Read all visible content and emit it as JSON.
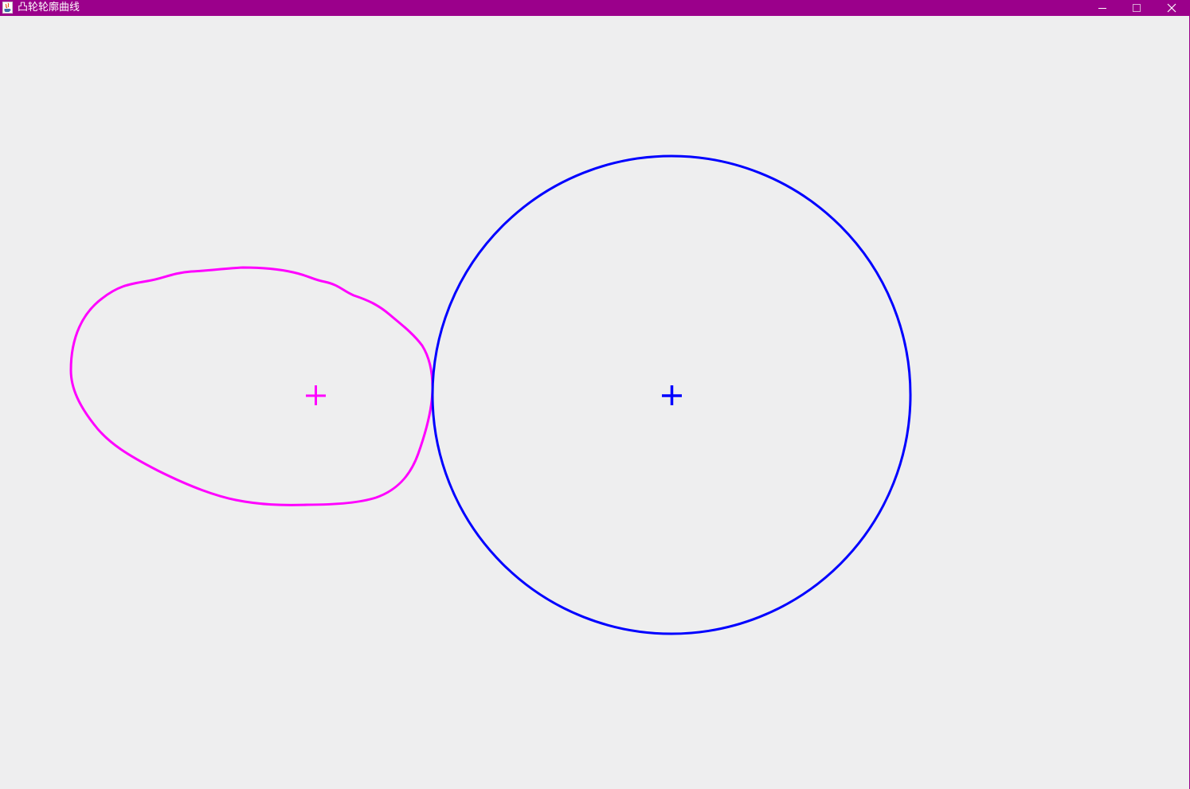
{
  "window": {
    "title": "凸轮轮廓曲线",
    "titlebar_color": "#9b008b",
    "background_color": "#eeeeef",
    "controls": {
      "minimize_icon": "minimize-icon",
      "maximize_icon": "maximize-icon",
      "close_icon": "close-icon"
    }
  },
  "drawing": {
    "cam_profile_color": "#ff00ff",
    "base_circle_color": "#0000ff"
  }
}
